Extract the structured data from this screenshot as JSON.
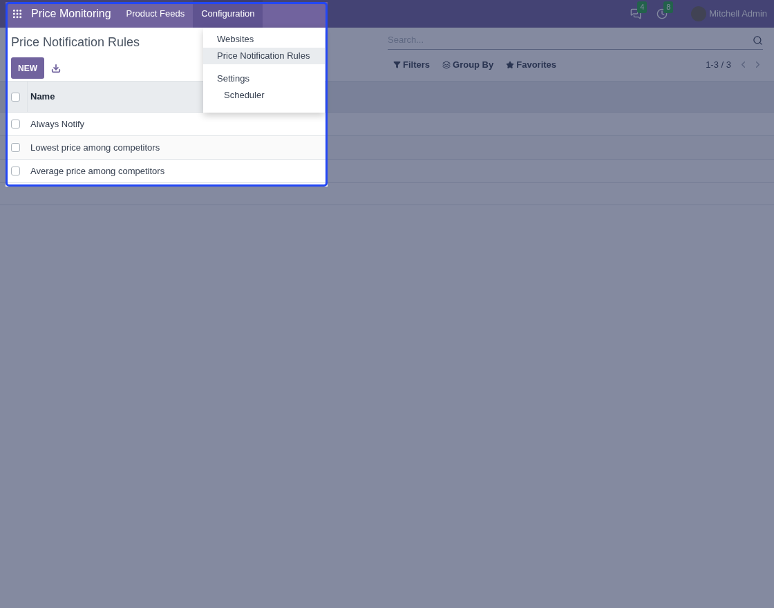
{
  "navbar": {
    "app_name": "Price Monitoring",
    "menus": [
      {
        "label": "Product Feeds",
        "selected": false
      },
      {
        "label": "Configuration",
        "selected": true
      }
    ],
    "messages_badge": "4",
    "activities_badge": "8",
    "user": "Mitchell Admin"
  },
  "dropdown": {
    "items": [
      {
        "kind": "item",
        "label": "Websites",
        "selected": false
      },
      {
        "kind": "item",
        "label": "Price Notification Rules",
        "selected": true
      },
      {
        "kind": "header",
        "label": "Settings",
        "selected": false
      },
      {
        "kind": "subitem",
        "label": "Scheduler",
        "selected": false
      }
    ]
  },
  "control_panel": {
    "title": "Price Notification Rules",
    "new_button": "NEW",
    "search": {
      "placeholder": "Search..."
    },
    "filters": "Filters",
    "group_by": "Group By",
    "favorites": "Favorites",
    "pager": "1-3 / 3"
  },
  "table": {
    "select_all_checked": false,
    "columns": [
      "Name"
    ],
    "rows": [
      {
        "name": "Always Notify",
        "checked": false
      },
      {
        "name": "Lowest price among competitors",
        "checked": false
      },
      {
        "name": "Average price among competitors",
        "checked": false
      }
    ]
  }
}
